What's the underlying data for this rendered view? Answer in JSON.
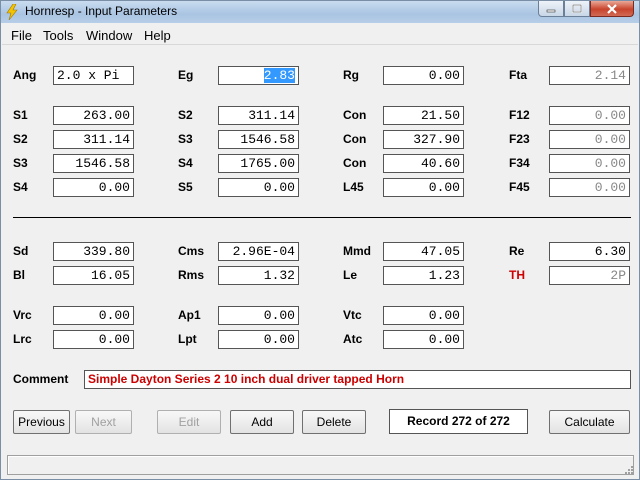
{
  "window": {
    "title": "Hornresp - Input Parameters"
  },
  "menu": [
    "File",
    "Tools",
    "Window",
    "Help"
  ],
  "fields": {
    "ang": {
      "label": "Ang",
      "value": "2.0 x Pi"
    },
    "eg": {
      "label": "Eg",
      "value": "2.83"
    },
    "rg": {
      "label": "Rg",
      "value": "0.00"
    },
    "fta": {
      "label": "Fta",
      "value": "2.14"
    },
    "s1": {
      "label": "S1",
      "value": "263.00"
    },
    "s2a": {
      "label": "S2",
      "value": "311.14"
    },
    "con1": {
      "label": "Con",
      "value": "21.50"
    },
    "f12": {
      "label": "F12",
      "value": "0.00"
    },
    "s2b": {
      "label": "S2",
      "value": "311.14"
    },
    "s3a": {
      "label": "S3",
      "value": "1546.58"
    },
    "con2": {
      "label": "Con",
      "value": "327.90"
    },
    "f23": {
      "label": "F23",
      "value": "0.00"
    },
    "s3b": {
      "label": "S3",
      "value": "1546.58"
    },
    "s4a": {
      "label": "S4",
      "value": "1765.00"
    },
    "con3": {
      "label": "Con",
      "value": "40.60"
    },
    "f34": {
      "label": "F34",
      "value": "0.00"
    },
    "s4b": {
      "label": "S4",
      "value": "0.00"
    },
    "s5": {
      "label": "S5",
      "value": "0.00"
    },
    "l45": {
      "label": "L45",
      "value": "0.00"
    },
    "f45": {
      "label": "F45",
      "value": "0.00"
    },
    "sd": {
      "label": "Sd",
      "value": "339.80"
    },
    "cms": {
      "label": "Cms",
      "value": "2.96E-04"
    },
    "mmd": {
      "label": "Mmd",
      "value": "47.05"
    },
    "re": {
      "label": "Re",
      "value": "6.30"
    },
    "bl": {
      "label": "Bl",
      "value": "16.05"
    },
    "rms": {
      "label": "Rms",
      "value": "1.32"
    },
    "le": {
      "label": "Le",
      "value": "1.23"
    },
    "th": {
      "label": "TH",
      "value": "2P"
    },
    "vrc": {
      "label": "Vrc",
      "value": "0.00"
    },
    "ap1": {
      "label": "Ap1",
      "value": "0.00"
    },
    "vtc": {
      "label": "Vtc",
      "value": "0.00"
    },
    "lrc": {
      "label": "Lrc",
      "value": "0.00"
    },
    "lpt": {
      "label": "Lpt",
      "value": "0.00"
    },
    "atc": {
      "label": "Atc",
      "value": "0.00"
    }
  },
  "comment": {
    "label": "Comment",
    "value": "Simple Dayton Series 2 10 inch dual driver tapped Horn"
  },
  "buttons": {
    "previous": "Previous",
    "next": "Next",
    "edit": "Edit",
    "add": "Add",
    "delete": "Delete",
    "calculate": "Calculate"
  },
  "record": "Record 272 of 272",
  "colors": {
    "accent_red": "#cc0000",
    "selection": "#3399ff"
  }
}
